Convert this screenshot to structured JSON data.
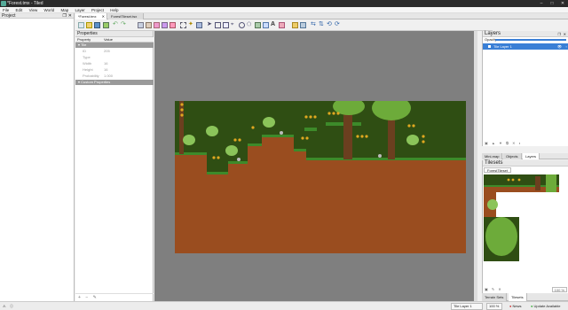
{
  "window": {
    "title": "*Forest.tmx - Tiled"
  },
  "menu": [
    "File",
    "Edit",
    "View",
    "World",
    "Map",
    "Layer",
    "Project",
    "Help"
  ],
  "project_panel": {
    "title": "Project"
  },
  "doc_tabs": [
    "*Forest.tmx",
    "ForestTileset.tsx"
  ],
  "properties": {
    "title": "Properties",
    "col_property": "Property",
    "col_value": "Value",
    "section": "Tile",
    "rows": [
      {
        "key": "ID",
        "value": "205"
      },
      {
        "key": "Type",
        "value": ""
      },
      {
        "key": "Width",
        "value": "16"
      },
      {
        "key": "Height",
        "value": "16"
      },
      {
        "key": "Probability",
        "value": "1.000"
      }
    ],
    "custom": "Custom Properties"
  },
  "layers_panel": {
    "title": "Layers",
    "opacity_label": "Opacity:",
    "layer_name": "Tile Layer 1"
  },
  "mid_tabs": [
    "Mini-map",
    "Objects",
    "Layers"
  ],
  "tilesets_panel": {
    "title": "Tilesets",
    "tab": "ForestTileset",
    "zoom": "100 %"
  },
  "bottom_tabs": [
    "Terrain Sets",
    "Tilesets"
  ],
  "status": {
    "layer": "Tile Layer 1",
    "zoom": "100 %",
    "news": "News",
    "update": "Update Available"
  },
  "colors": {
    "canvas_bg": "#7f7f7f",
    "sky": "#2f4e13",
    "dirt": "#9a4d1f",
    "grass": "#3d8a2a",
    "selection": "#3a7fd6"
  }
}
